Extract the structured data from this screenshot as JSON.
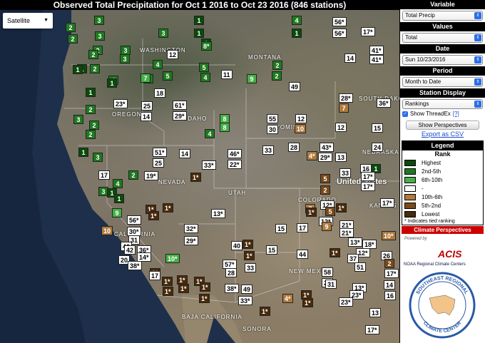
{
  "title": "Observed Total Precipitation for Oct 1 2016 to Oct 23 2016 (846 stations)",
  "map_type": {
    "value": "Satellite"
  },
  "panel": {
    "variable": {
      "header": "Variable",
      "value": "Total Precip"
    },
    "values": {
      "header": "Values",
      "value": "Total"
    },
    "date": {
      "header": "Date",
      "value": "Sun 10/23/2016"
    },
    "period": {
      "header": "Period",
      "value": "Month to Date"
    },
    "station_display": {
      "header": "Station Display",
      "value": "Rankings"
    },
    "threadex": {
      "label": "Show ThreadEx",
      "help": "[?]",
      "checked": true
    },
    "perspectives_button": "Show Perspectives",
    "export_link": "Export as CSV"
  },
  "legend": {
    "header": "Legend",
    "rank_label": "Rank",
    "items": [
      {
        "label": "Highest",
        "color": "#0b4a0b"
      },
      {
        "label": "2nd-5th",
        "color": "#1f7a1f"
      },
      {
        "label": "6th-10th",
        "color": "#45b045"
      },
      {
        "label": "-",
        "color": "#ffffff"
      },
      {
        "label": "10th-6th",
        "color": "#b07a3c"
      },
      {
        "label": "5th-2nd",
        "color": "#7a4a1a"
      },
      {
        "label": "Lowest",
        "color": "#4a2a0a"
      }
    ],
    "note": "* Indicates tied ranking"
  },
  "climate_perspectives": "Climate Perspectives",
  "powered_by": "Powered by",
  "acis": "ACIS",
  "noaa_rcc": "NOAA Regional Climate Centers",
  "serc": {
    "line1": "SOUTHEAST REGIONAL",
    "line2": "CLIMATE CENTER"
  },
  "map_labels": {
    "washington": "WASHINGTON",
    "montana": "MONTANA",
    "south_dakota": "SOUTH DAKOTA",
    "oregon": "OREGON",
    "idaho": "IDAHO",
    "wyoming": "WYOMING",
    "nebraska": "NEBRASKA",
    "nevada": "NEVADA",
    "united_states": "United States",
    "utah": "UTAH",
    "colorado": "COLORADO",
    "kansas": "KANSAS",
    "california": "CALIFORNIA",
    "new_mexico": "NEW MEXICO",
    "baja_california": "BAJA CALIFORNIA",
    "sonora": "SONORA"
  },
  "stations": [
    {
      "t": "1",
      "r": "r-hi"
    },
    {
      "t": "3",
      "r": "r-2"
    },
    {
      "t": "1",
      "r": "r-hi"
    },
    {
      "t": "4",
      "r": "r-2"
    },
    {
      "t": "56*",
      "r": "r-mid"
    },
    {
      "t": "17*",
      "r": "r-mid"
    },
    {
      "t": "2",
      "r": "r-2"
    },
    {
      "t": "3",
      "r": "r-2"
    },
    {
      "t": "3",
      "r": "r-2"
    },
    {
      "t": "1",
      "r": "r-hi"
    },
    {
      "t": "2",
      "r": "r-2"
    },
    {
      "t": "56*",
      "r": "r-mid"
    },
    {
      "t": "2",
      "r": "r-2"
    },
    {
      "t": "1",
      "r": "r-hi"
    },
    {
      "t": "8*",
      "r": "r-2"
    },
    {
      "t": "41*",
      "r": "r-mid"
    },
    {
      "t": "2",
      "r": "r-2"
    },
    {
      "t": "3",
      "r": "r-2"
    },
    {
      "t": "3",
      "r": "r-2"
    },
    {
      "t": "12",
      "r": "r-mid"
    },
    {
      "t": "4",
      "r": "r-2"
    },
    {
      "t": "2",
      "r": "r-2"
    },
    {
      "t": "14",
      "r": "r-mid"
    },
    {
      "t": "41*",
      "r": "r-mid"
    },
    {
      "t": "1",
      "r": "r-hi"
    },
    {
      "t": "2",
      "r": "r-2"
    },
    {
      "t": "1",
      "r": "r-hi"
    },
    {
      "t": "5",
      "r": "r-2"
    },
    {
      "t": "5",
      "r": "r-2"
    },
    {
      "t": "4",
      "r": "r-2"
    },
    {
      "t": "2",
      "r": "r-2"
    },
    {
      "t": "11",
      "r": "r-mid"
    },
    {
      "t": "9",
      "r": "r-6"
    },
    {
      "t": "2",
      "r": "r-2"
    },
    {
      "t": "7",
      "r": "r-6"
    },
    {
      "t": "4",
      "r": "r-2"
    },
    {
      "t": "1",
      "r": "r-hi"
    },
    {
      "t": "49",
      "r": "r-mid"
    },
    {
      "t": "18",
      "r": "r-mid"
    },
    {
      "t": "28*",
      "r": "r-mid"
    },
    {
      "t": "1",
      "r": "r-hi"
    },
    {
      "t": "23*",
      "r": "r-mid"
    },
    {
      "t": "25",
      "r": "r-mid"
    },
    {
      "t": "61*",
      "r": "r-mid"
    },
    {
      "t": "36*",
      "r": "r-mid"
    },
    {
      "t": "2",
      "r": "r-2"
    },
    {
      "t": "14",
      "r": "r-mid"
    },
    {
      "t": "29*",
      "r": "r-mid"
    },
    {
      "t": "8",
      "r": "r-6"
    },
    {
      "t": "55",
      "r": "r-mid"
    },
    {
      "t": "12",
      "r": "r-mid"
    },
    {
      "t": "7",
      "r": "r-10"
    },
    {
      "t": "3",
      "r": "r-2"
    },
    {
      "t": "2",
      "r": "r-2"
    },
    {
      "t": "8",
      "r": "r-6"
    },
    {
      "t": "30",
      "r": "r-mid"
    },
    {
      "t": "10",
      "r": "r-10"
    },
    {
      "t": "12",
      "r": "r-mid"
    },
    {
      "t": "15",
      "r": "r-mid"
    },
    {
      "t": "2",
      "r": "r-2"
    },
    {
      "t": "4",
      "r": "r-2"
    },
    {
      "t": "28",
      "r": "r-mid"
    },
    {
      "t": "43*",
      "r": "r-mid"
    },
    {
      "t": "24",
      "r": "r-mid"
    },
    {
      "t": "1",
      "r": "r-hi"
    },
    {
      "t": "51*",
      "r": "r-mid"
    },
    {
      "t": "14",
      "r": "r-mid"
    },
    {
      "t": "46*",
      "r": "r-mid"
    },
    {
      "t": "33",
      "r": "r-mid"
    },
    {
      "t": "4*",
      "r": "r-10"
    },
    {
      "t": "29*",
      "r": "r-mid"
    },
    {
      "t": "13",
      "r": "r-mid"
    },
    {
      "t": "3",
      "r": "r-2"
    },
    {
      "t": "25",
      "r": "r-mid"
    },
    {
      "t": "33*",
      "r": "r-mid"
    },
    {
      "t": "22*",
      "r": "r-mid"
    },
    {
      "t": "16",
      "r": "r-mid"
    },
    {
      "t": "1",
      "r": "r-hi"
    },
    {
      "t": "17",
      "r": "r-mid"
    },
    {
      "t": "2",
      "r": "r-2"
    },
    {
      "t": "19*",
      "r": "r-mid"
    },
    {
      "t": "1*",
      "r": "r-lo"
    },
    {
      "t": "5",
      "r": "r-5"
    },
    {
      "t": "33",
      "r": "r-mid"
    },
    {
      "t": "17*",
      "r": "r-mid"
    },
    {
      "t": "4",
      "r": "r-2"
    },
    {
      "t": "3",
      "r": "r-2"
    },
    {
      "t": "1",
      "r": "r-hi"
    },
    {
      "t": "1",
      "r": "r-hi"
    },
    {
      "t": "2",
      "r": "r-5"
    },
    {
      "t": "17*",
      "r": "r-mid"
    },
    {
      "t": "1*",
      "r": "r-lo"
    },
    {
      "t": "1*",
      "r": "r-lo"
    },
    {
      "t": "13*",
      "r": "r-mid"
    },
    {
      "t": "12*",
      "r": "r-mid"
    },
    {
      "t": "1*",
      "r": "r-lo"
    },
    {
      "t": "17*",
      "r": "r-mid"
    },
    {
      "t": "9",
      "r": "r-6"
    },
    {
      "t": "56*",
      "r": "r-mid"
    },
    {
      "t": "7",
      "r": "r-10"
    },
    {
      "t": "1*",
      "r": "r-lo"
    },
    {
      "t": "5",
      "r": "r-5"
    },
    {
      "t": "1*",
      "r": "r-lo"
    },
    {
      "t": "12*",
      "r": "r-mid"
    },
    {
      "t": "21*",
      "r": "r-mid"
    },
    {
      "t": "10",
      "r": "r-10"
    },
    {
      "t": "30*",
      "r": "r-mid"
    },
    {
      "t": "15",
      "r": "r-mid"
    },
    {
      "t": "17",
      "r": "r-mid"
    },
    {
      "t": "9",
      "r": "r-10"
    },
    {
      "t": "10*",
      "r": "r-10"
    },
    {
      "t": "31",
      "r": "r-mid"
    },
    {
      "t": "32*",
      "r": "r-mid"
    },
    {
      "t": "21*",
      "r": "r-mid"
    },
    {
      "t": "13*",
      "r": "r-mid"
    },
    {
      "t": "29*",
      "r": "r-mid"
    },
    {
      "t": "40",
      "r": "r-mid"
    },
    {
      "t": "1*",
      "r": "r-lo"
    },
    {
      "t": "42",
      "r": "r-mid"
    },
    {
      "t": "18*",
      "r": "r-mid"
    },
    {
      "t": "42",
      "r": "r-mid"
    },
    {
      "t": "36*",
      "r": "r-mid"
    },
    {
      "t": "1*",
      "r": "r-lo"
    },
    {
      "t": "15",
      "r": "r-mid"
    },
    {
      "t": "12*",
      "r": "r-mid"
    },
    {
      "t": "26",
      "r": "r-mid"
    },
    {
      "t": "20",
      "r": "r-mid"
    },
    {
      "t": "14*",
      "r": "r-mid"
    },
    {
      "t": "10*",
      "r": "r-6"
    },
    {
      "t": "44",
      "r": "r-mid"
    },
    {
      "t": "1*",
      "r": "r-lo"
    },
    {
      "t": "37",
      "r": "r-mid"
    },
    {
      "t": "2",
      "r": "r-5"
    },
    {
      "t": "38*",
      "r": "r-mid"
    },
    {
      "t": "57*",
      "r": "r-mid"
    },
    {
      "t": "28",
      "r": "r-mid"
    },
    {
      "t": "33",
      "r": "r-mid"
    },
    {
      "t": "51",
      "r": "r-mid"
    },
    {
      "t": "17*",
      "r": "r-mid"
    },
    {
      "t": "1*",
      "r": "r-lo"
    },
    {
      "t": "17",
      "r": "r-mid"
    },
    {
      "t": "1*",
      "r": "r-lo"
    },
    {
      "t": "58",
      "r": "r-mid"
    },
    {
      "t": "21",
      "r": "r-mid"
    },
    {
      "t": "13*",
      "r": "r-mid"
    },
    {
      "t": "1*",
      "r": "r-lo"
    },
    {
      "t": "1*",
      "r": "r-lo"
    },
    {
      "t": "1*",
      "r": "r-lo"
    },
    {
      "t": "38*",
      "r": "r-mid"
    },
    {
      "t": "31",
      "r": "r-mid"
    },
    {
      "t": "23*",
      "r": "r-mid"
    },
    {
      "t": "14",
      "r": "r-mid"
    },
    {
      "t": "1*",
      "r": "r-lo"
    },
    {
      "t": "1*",
      "r": "r-lo"
    },
    {
      "t": "1*",
      "r": "r-lo"
    },
    {
      "t": "49",
      "r": "r-mid"
    },
    {
      "t": "4*",
      "r": "r-10"
    },
    {
      "t": "1*",
      "r": "r-lo"
    },
    {
      "t": "1*",
      "r": "r-lo"
    },
    {
      "t": "16",
      "r": "r-mid"
    },
    {
      "t": "33*",
      "r": "r-mid"
    },
    {
      "t": "1*",
      "r": "r-lo"
    },
    {
      "t": "23*",
      "r": "r-mid"
    },
    {
      "t": "13",
      "r": "r-mid"
    },
    {
      "t": "17*",
      "r": "r-mid"
    }
  ]
}
